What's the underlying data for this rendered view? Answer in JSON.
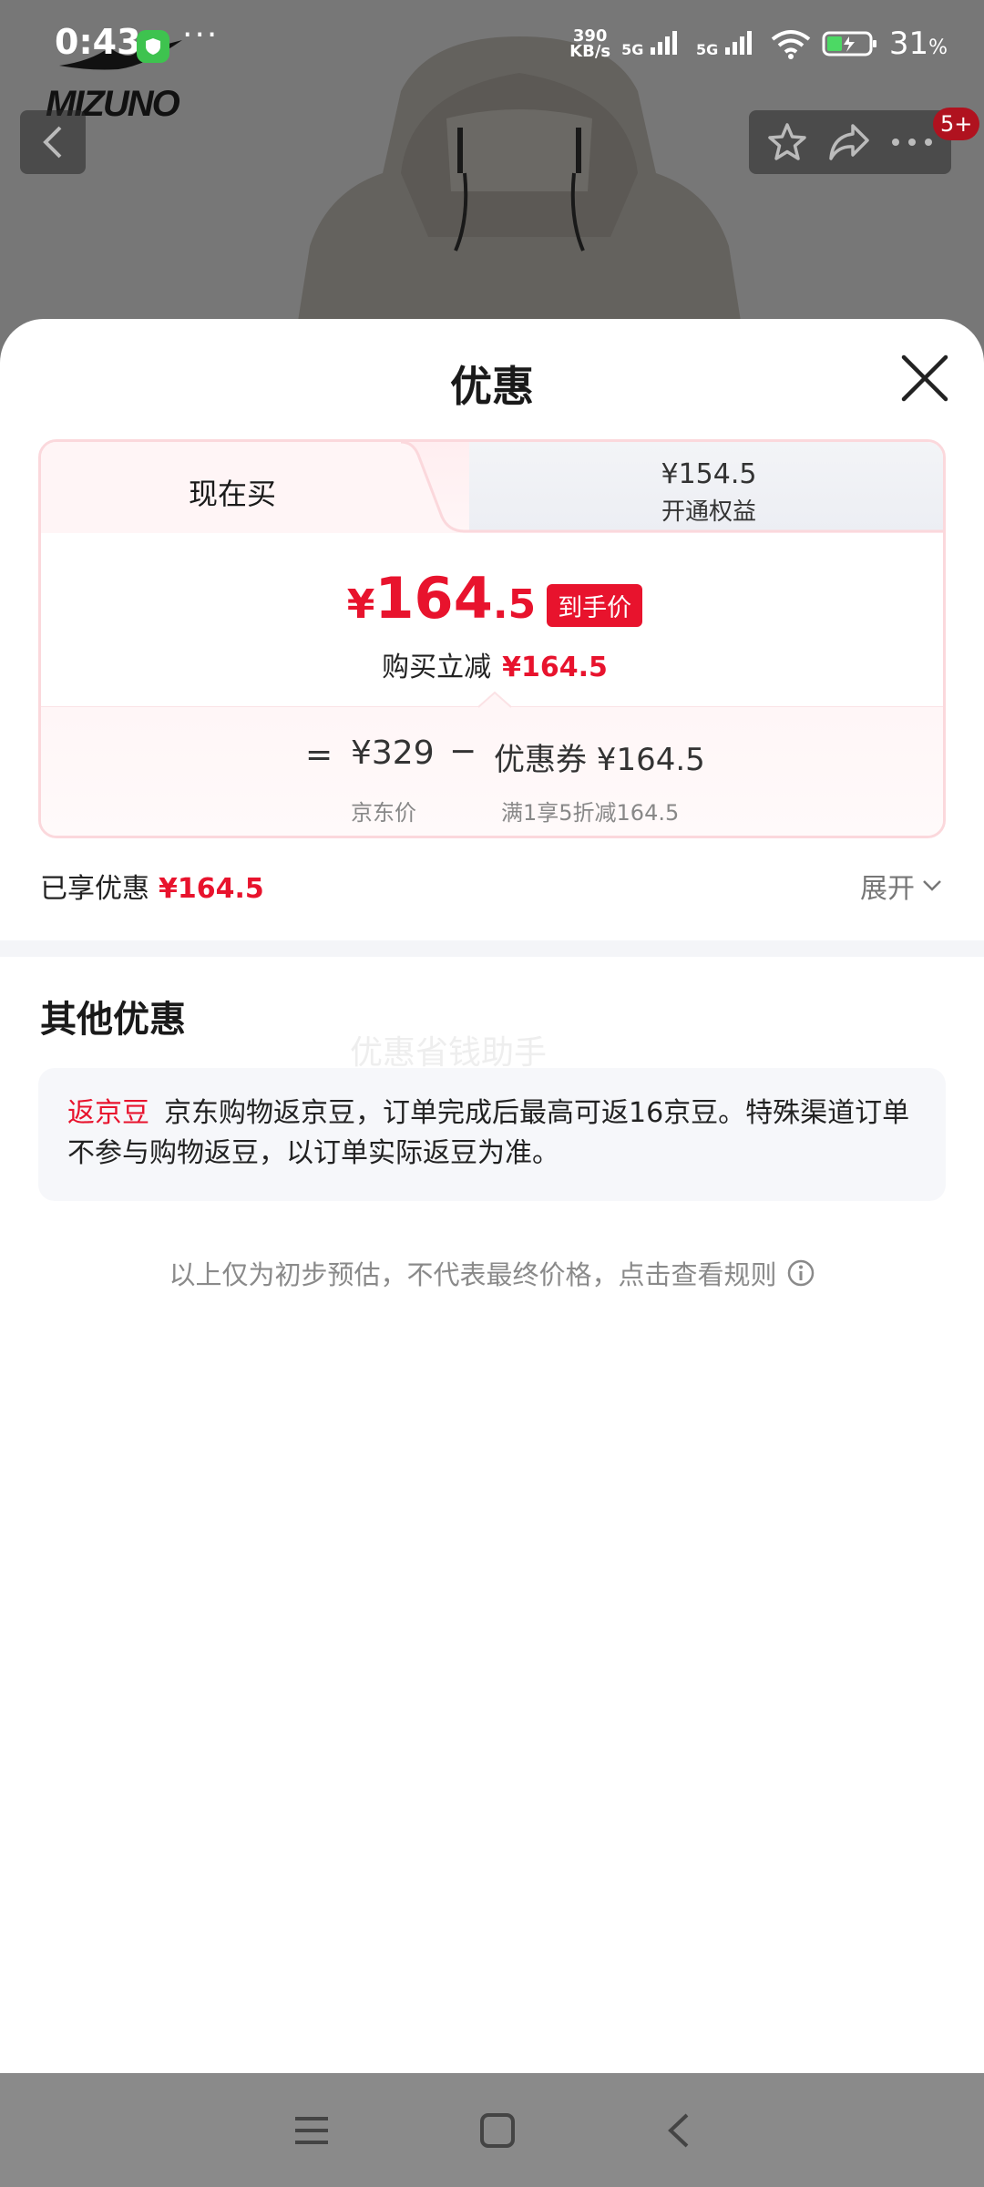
{
  "status_bar": {
    "time": "0:43",
    "net_speed_value": "390",
    "net_speed_unit": "KB/s",
    "signal1": "5G",
    "signal2": "5G",
    "battery_pct": "31",
    "battery_unit": "%"
  },
  "product_page": {
    "brand_logo_text": "MIZUNO",
    "cart_badge": "5+"
  },
  "sheet": {
    "title": "优惠",
    "tabs": {
      "buy_now_label": "现在买",
      "member_price": "¥154.5",
      "member_label": "开通权益"
    },
    "final_price": {
      "currency": "¥",
      "integer": "164",
      "decimal": ".5",
      "badge": "到手价"
    },
    "instant_reduction": {
      "label": "购买立减",
      "amount": "¥164.5"
    },
    "formula": {
      "equals": "=",
      "jd_price": "¥329",
      "minus": "−",
      "coupon": "优惠券 ¥164.5",
      "jd_price_label": "京东价",
      "coupon_rule": "满1享5折减164.5"
    },
    "enjoyed": {
      "label": "已享优惠",
      "amount": "¥164.5"
    },
    "expand_label": "展开",
    "other_title": "其他优惠",
    "watermark": "优惠省钱助手",
    "jd_bean": {
      "tag": "返京豆",
      "text": "京东购物返京豆，订单完成后最高可返16京豆。特殊渠道订单不参与购物返豆，以订单实际返豆为准。"
    },
    "note": "以上仅为初步预估，不代表最终价格，点击查看规则"
  },
  "colors": {
    "accent_red": "#e8132d",
    "card_border": "#fbd8dc"
  }
}
